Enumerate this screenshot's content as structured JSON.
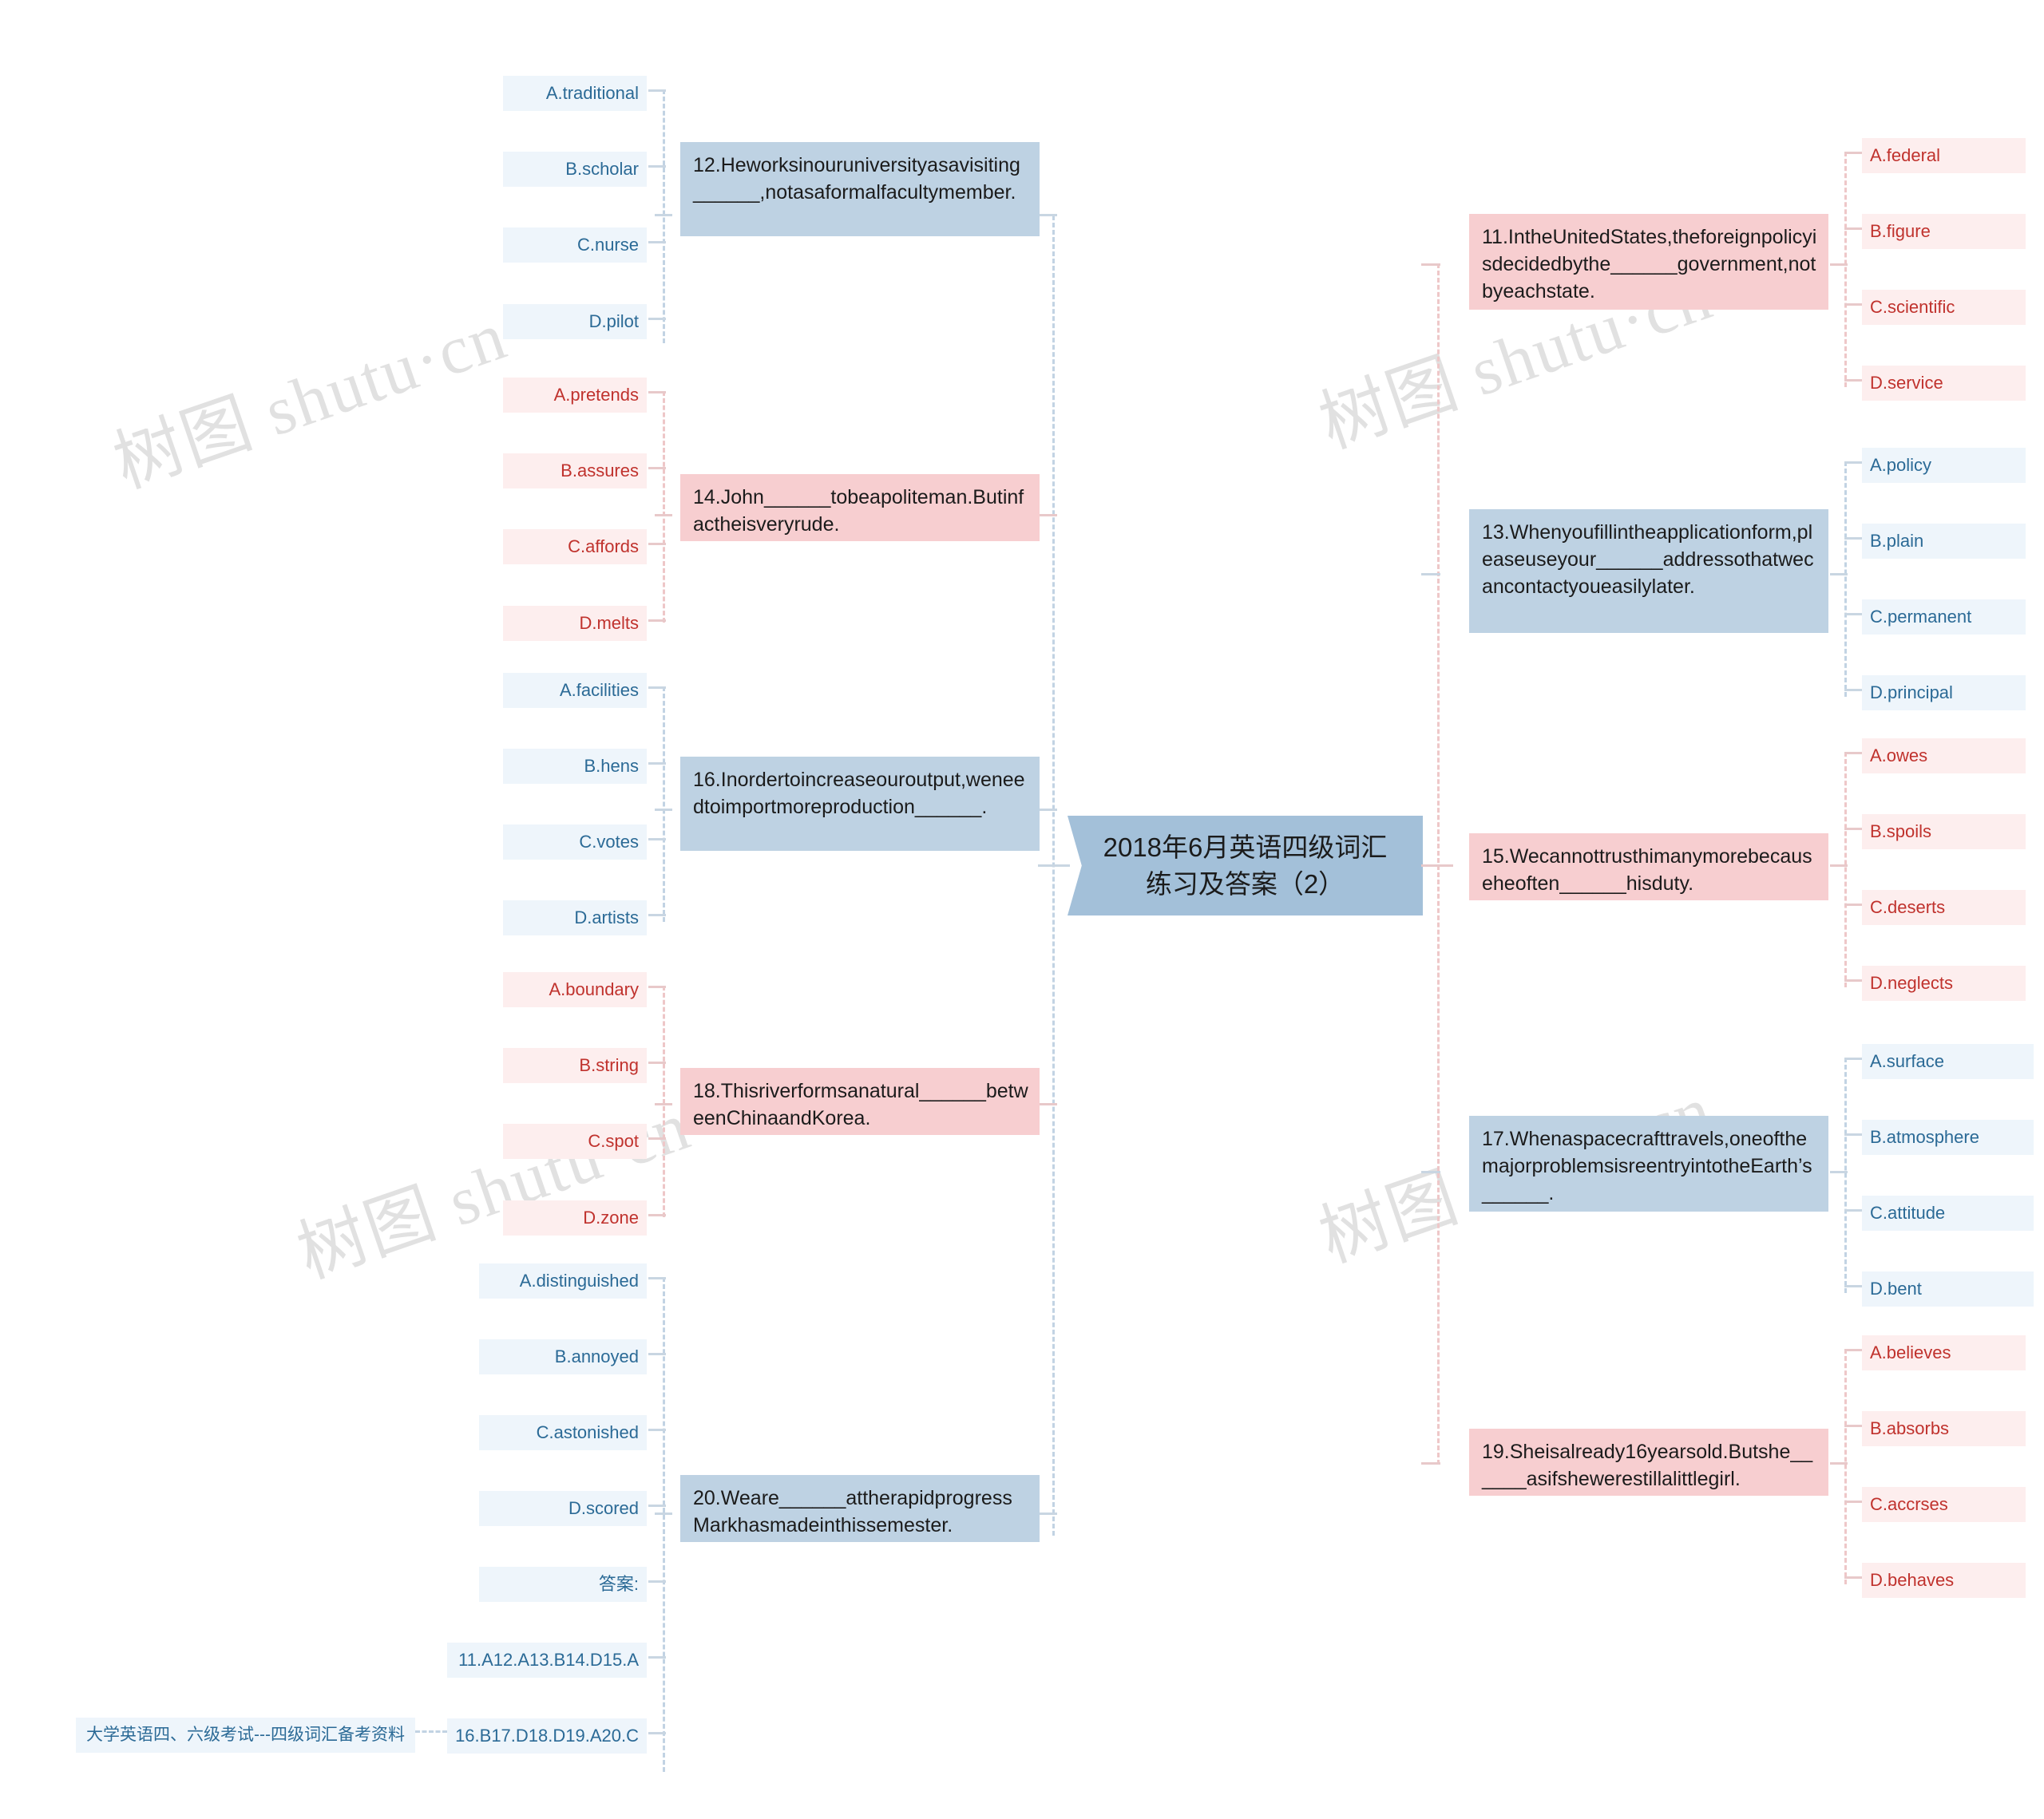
{
  "central": {
    "title": "2018年6月英语四级词汇练习及答案（2）"
  },
  "root_label": "大学英语四、六级考试---四级词汇备考资料",
  "watermark": "树图 shutu·cn",
  "colors": {
    "blue_branch": "#2b6a96",
    "red_branch": "#c0322d",
    "blue_box": "#bed2e3",
    "red_box": "#f7ced0",
    "central_fill": "#a3c0d9",
    "connector_blue": "#c2d3e3",
    "connector_red": "#eec7c8"
  },
  "left_branches": [
    {
      "id": "q12",
      "tone": "blue",
      "question": "12.Heworksinouruniversityasavisiting______,notasaformalfacultymember.",
      "options": [
        "A.traditional",
        "B.scholar",
        "C.nurse",
        "D.pilot"
      ]
    },
    {
      "id": "q14",
      "tone": "red",
      "question": "14.John______tobeapoliteman.Butinfactheisveryrude.",
      "options": [
        "A.pretends",
        "B.assures",
        "C.affords",
        "D.melts"
      ]
    },
    {
      "id": "q16",
      "tone": "blue",
      "question": "16.Inordertoincreaseouroutput,weneedtoimportmoreproduction______.",
      "options": [
        "A.facilities",
        "B.hens",
        "C.votes",
        "D.artists"
      ]
    },
    {
      "id": "q18",
      "tone": "red",
      "question": "18.Thisriverformsanatural______betweenChinaandKorea.",
      "options": [
        "A.boundary",
        "B.string",
        "C.spot",
        "D.zone"
      ]
    },
    {
      "id": "q20",
      "tone": "blue",
      "question": "20.Weare______attherapidprogressMarkhasmadeinthissemester.",
      "options": [
        "A.distinguished",
        "B.annoyed",
        "C.astonished",
        "D.scored"
      ]
    }
  ],
  "answers_branch": {
    "label": "答案:",
    "lines": [
      "11.A12.A13.B14.D15.A",
      "16.B17.D18.D19.A20.C"
    ]
  },
  "right_branches": [
    {
      "id": "q11",
      "tone": "red",
      "question": "11.IntheUnitedStates,theforeignpolicyisdecidedbythe______government,notbyeachstate.",
      "options": [
        "A.federal",
        "B.figure",
        "C.scientific",
        "D.service"
      ]
    },
    {
      "id": "q13",
      "tone": "blue",
      "question": "13.Whenyoufillintheapplicationform,pleaseuseyour______addressothatwecancontactyoueasilylater.",
      "options": [
        "A.policy",
        "B.plain",
        "C.permanent",
        "D.principal"
      ]
    },
    {
      "id": "q15",
      "tone": "red",
      "question": "15.Wecannottrusthimanymorebecauseheoften______hisduty.",
      "options": [
        "A.owes",
        "B.spoils",
        "C.deserts",
        "D.neglects"
      ]
    },
    {
      "id": "q17",
      "tone": "blue",
      "question": "17.Whenaspacecrafttravels,oneofthemajorproblemsisreentryintotheEarth’s______.",
      "options": [
        "A.surface",
        "B.atmosphere",
        "C.attitude",
        "D.bent"
      ]
    },
    {
      "id": "q19",
      "tone": "red",
      "question": "19.Sheisalready16yearsold.Butshe______asifshewerestillalittlegirl.",
      "options": [
        "A.believes",
        "B.absorbs",
        "C.accrses",
        "D.behaves"
      ]
    }
  ]
}
